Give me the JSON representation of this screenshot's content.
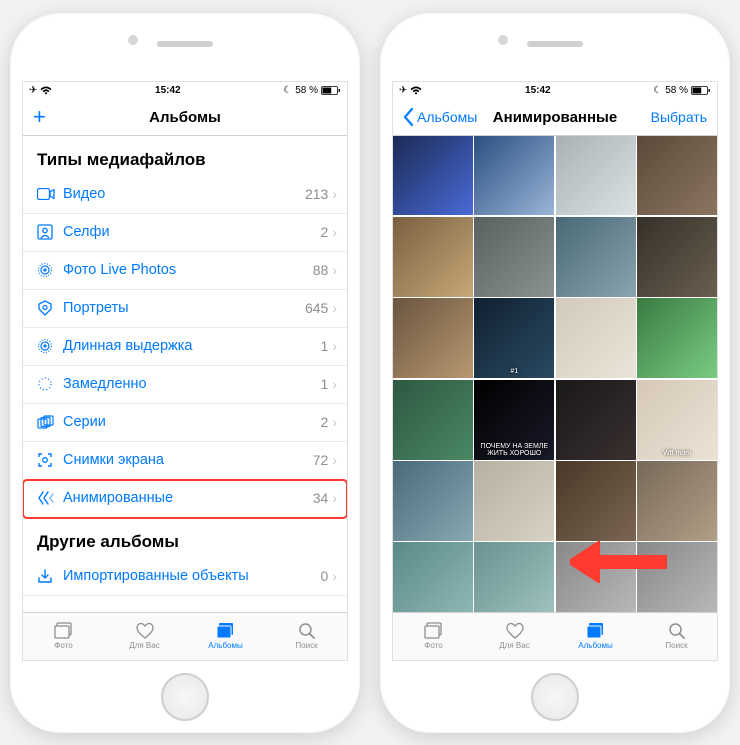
{
  "status": {
    "time": "15:42",
    "battery": "58 %"
  },
  "left_screen": {
    "nav": {
      "title": "Альбомы",
      "add": "+"
    },
    "section1": "Типы медиафайлов",
    "rows": [
      {
        "label": "Видео",
        "count": "213"
      },
      {
        "label": "Селфи",
        "count": "2"
      },
      {
        "label": "Фото Live Photos",
        "count": "88"
      },
      {
        "label": "Портреты",
        "count": "645"
      },
      {
        "label": "Длинная выдержка",
        "count": "1"
      },
      {
        "label": "Замедленно",
        "count": "1"
      },
      {
        "label": "Серии",
        "count": "2"
      },
      {
        "label": "Снимки экрана",
        "count": "72"
      },
      {
        "label": "Анимированные",
        "count": "34"
      }
    ],
    "section2": "Другие альбомы",
    "rows2": [
      {
        "label": "Импортированные объекты",
        "count": "0"
      }
    ]
  },
  "right_screen": {
    "nav": {
      "back": "Альбомы",
      "title": "Анимированные",
      "select": "Выбрать"
    },
    "thumbs": [
      {
        "label": ""
      },
      {
        "label": ""
      },
      {
        "label": ""
      },
      {
        "label": ""
      },
      {
        "label": ""
      },
      {
        "label": ""
      },
      {
        "label": ""
      },
      {
        "label": ""
      },
      {
        "label": ""
      },
      {
        "label": "#1"
      },
      {
        "label": ""
      },
      {
        "label": ""
      },
      {
        "label": ""
      },
      {
        "label": "ПОЧЕМУ НА ЗЕМЛЕ ЖИТЬ ХОРОШО"
      },
      {
        "label": ""
      },
      {
        "label": "Wtf mom"
      },
      {
        "label": ""
      },
      {
        "label": ""
      },
      {
        "label": ""
      },
      {
        "label": ""
      },
      {
        "label": ""
      },
      {
        "label": ""
      },
      {
        "label": ""
      },
      {
        "label": ""
      }
    ]
  },
  "tabs": [
    {
      "label": "Фото"
    },
    {
      "label": "Для Вас"
    },
    {
      "label": "Альбомы"
    },
    {
      "label": "Поиск"
    }
  ]
}
